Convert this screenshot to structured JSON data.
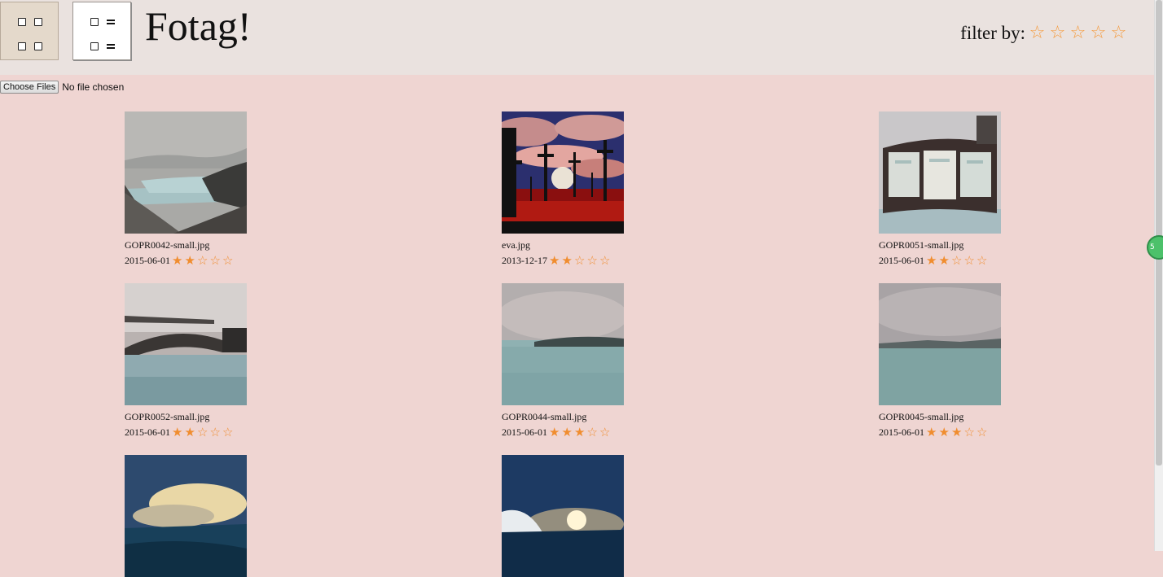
{
  "header": {
    "title": "Fotag!",
    "filter_label": "filter by:",
    "filter_stars": [
      "☆",
      "☆",
      "☆",
      "☆",
      "☆"
    ]
  },
  "toolbar": {
    "grid_view_icon": "grid-view-icon",
    "list_view_icon": "list-view-icon"
  },
  "upload": {
    "button_label": "Choose Files",
    "status": "No file chosen"
  },
  "colors": {
    "page_bg": "#efd5d2",
    "header_bg": "#eae2df",
    "star": "#f08d2f"
  },
  "photos": [
    {
      "filename": "GOPR0042-small.jpg",
      "date": "2015-06-01",
      "rating": 2,
      "stars": [
        "★",
        "★",
        "☆",
        "☆",
        "☆"
      ],
      "thumb": "lagoon-rocks"
    },
    {
      "filename": "eva.jpg",
      "date": "2013-12-17",
      "rating": 2,
      "stars": [
        "★",
        "★",
        "☆",
        "☆",
        "☆"
      ],
      "thumb": "red-crosses"
    },
    {
      "filename": "GOPR0051-small.jpg",
      "date": "2015-06-01",
      "rating": 2,
      "stars": [
        "★",
        "★",
        "☆",
        "☆",
        "☆"
      ],
      "thumb": "info-board"
    },
    {
      "filename": "GOPR0052-small.jpg",
      "date": "2015-06-01",
      "rating": 2,
      "stars": [
        "★",
        "★",
        "☆",
        "☆",
        "☆"
      ],
      "thumb": "bridge"
    },
    {
      "filename": "GOPR0044-small.jpg",
      "date": "2015-06-01",
      "rating": 3,
      "stars": [
        "★",
        "★",
        "★",
        "☆",
        "☆"
      ],
      "thumb": "misty-lagoon"
    },
    {
      "filename": "GOPR0045-small.jpg",
      "date": "2015-06-01",
      "rating": 3,
      "stars": [
        "★",
        "★",
        "★",
        "☆",
        "☆"
      ],
      "thumb": "misty-lagoon-2"
    },
    {
      "filename": "",
      "date": "",
      "rating": 0,
      "stars": [],
      "thumb": "sunset-clouds"
    },
    {
      "filename": "",
      "date": "",
      "rating": 0,
      "stars": [],
      "thumb": "sun-wave"
    }
  ],
  "extension_badge": "5"
}
